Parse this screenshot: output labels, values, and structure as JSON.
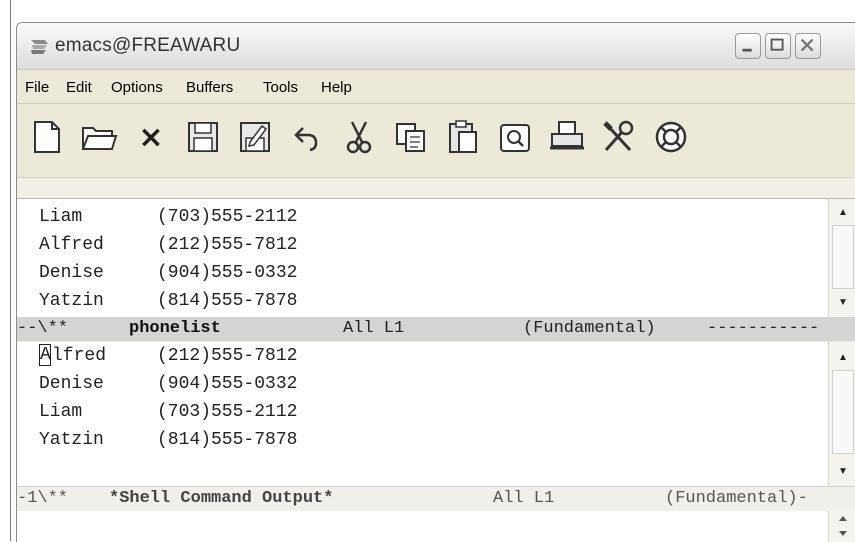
{
  "window": {
    "title": "emacs@FREAWARU"
  },
  "menu": [
    "File",
    "Edit",
    "Options",
    "Buffers",
    "Tools",
    "Help"
  ],
  "toolbar": {
    "icons": [
      "new-file-icon",
      "open-folder-icon",
      "close-buffer-icon",
      "save-icon",
      "save-as-icon",
      "undo-icon",
      "cut-icon",
      "copy-icon",
      "paste-icon",
      "search-icon",
      "print-icon",
      "preferences-icon",
      "help-icon"
    ],
    "close_glyph": "×"
  },
  "top_buffer": {
    "rows": [
      {
        "name": "Liam",
        "phone": "(703)555-2112"
      },
      {
        "name": "Alfred",
        "phone": "(212)555-7812"
      },
      {
        "name": "Denise",
        "phone": "(904)555-0332"
      },
      {
        "name": "Yatzin",
        "phone": "(814)555-7878"
      }
    ],
    "modeline": {
      "status": "--\\**",
      "buffer_name": "phonelist",
      "position": "All L1",
      "mode": "(Fundamental)",
      "fill": "-----------"
    }
  },
  "bottom_buffer": {
    "first_row_cursor_char": "A",
    "first_row_rest": "lfred",
    "first_row_phone": "(212)555-7812",
    "rows": [
      {
        "name": "Denise",
        "phone": "(904)555-0332"
      },
      {
        "name": "Liam",
        "phone": "(703)555-2112"
      },
      {
        "name": "Yatzin",
        "phone": "(814)555-7878"
      }
    ],
    "modeline": {
      "status": "-1\\**",
      "buffer_name": "*Shell Command Output*",
      "position": "All L1",
      "mode": "(Fundamental)-"
    }
  },
  "scrollbar": {
    "up_glyph": "▲",
    "down_glyph": "▼"
  },
  "colors": {
    "chrome": "#ece9d8",
    "modeline_active": "#d4d4d4",
    "text": "#222222"
  }
}
